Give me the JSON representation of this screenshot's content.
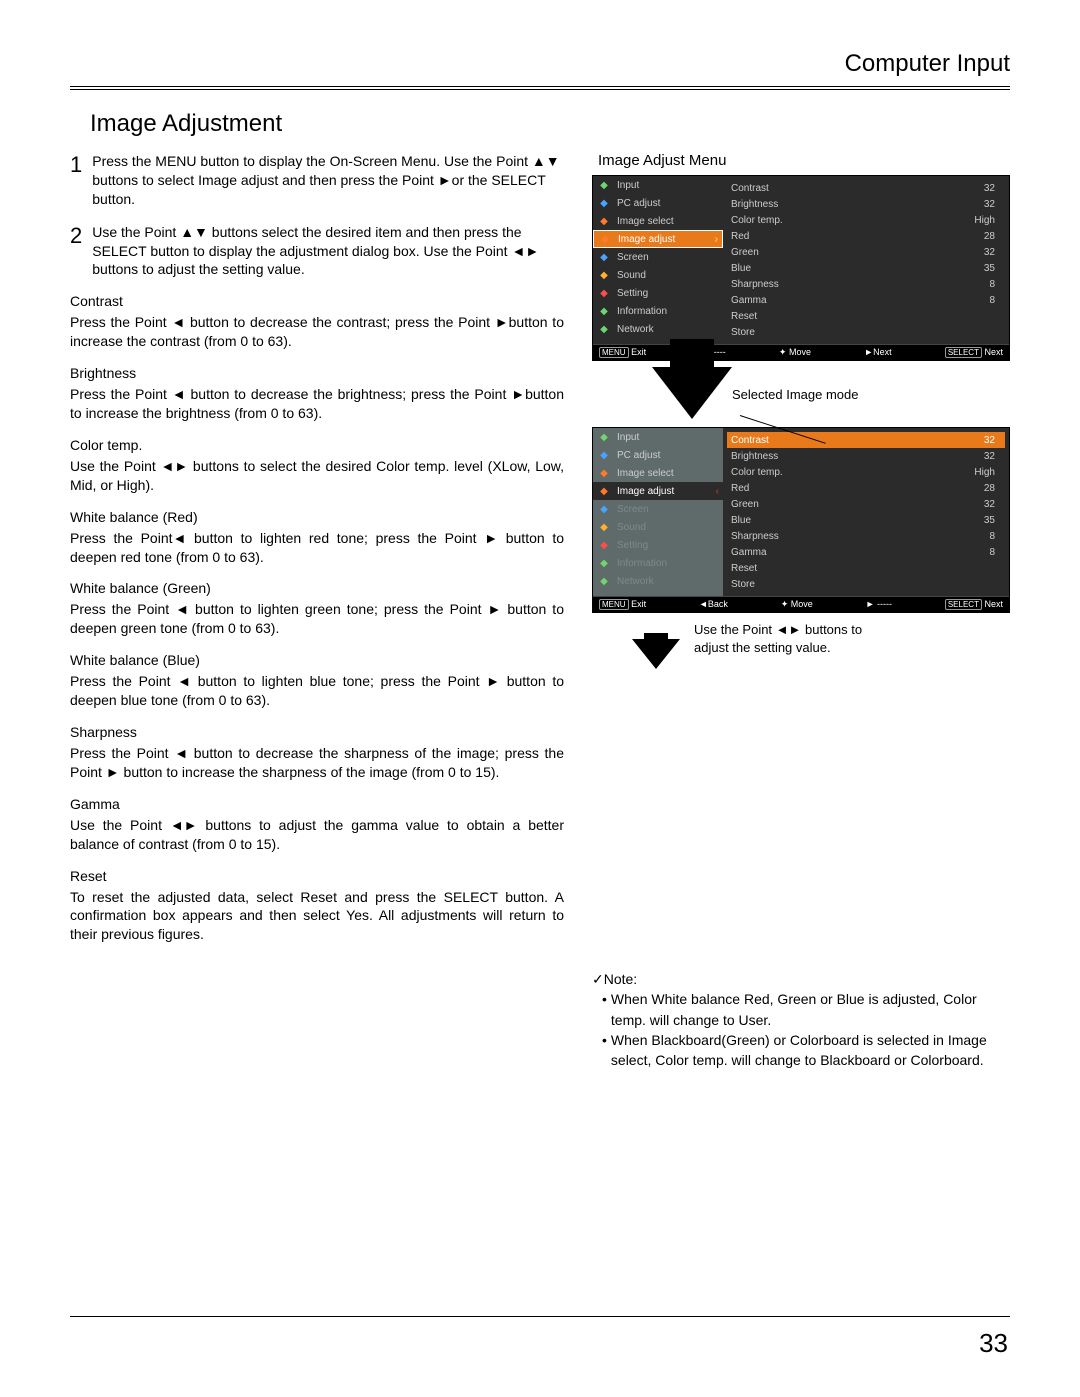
{
  "header": "Computer Input",
  "title": "Image Adjustment",
  "steps": [
    {
      "num": "1",
      "text": "Press the MENU button to display the On-Screen Menu. Use the Point ▲▼ buttons to select Image adjust  and then press the Point ►or the SELECT button."
    },
    {
      "num": "2",
      "text": "Use the Point ▲▼ buttons select the desired item and then press the SELECT button to display the adjustment dialog box. Use the Point ◄► buttons to adjust the setting value."
    }
  ],
  "params": [
    {
      "t": "Contrast",
      "b": "Press the Point ◄ button to decrease the contrast; press the Point ►button to increase the contrast (from 0 to 63)."
    },
    {
      "t": "Brightness",
      "b": "Press the Point ◄ button to decrease the brightness; press the Point ►button to increase the brightness (from 0 to 63)."
    },
    {
      "t": "Color temp.",
      "b": "Use the Point ◄► buttons to select the desired Color temp. level (XLow, Low, Mid, or High)."
    },
    {
      "t": "White balance (Red)",
      "b": "Press the Point◄ button to lighten red tone; press the Point ► button to deepen red tone (from 0 to 63)."
    },
    {
      "t": "White balance (Green)",
      "b": "Press the Point ◄ button to lighten green tone; press the Point ► button to deepen green tone (from 0 to 63)."
    },
    {
      "t": "White balance (Blue)",
      "b": "Press the Point ◄ button to lighten blue tone; press the Point ► button to deepen blue tone (from 0 to 63)."
    },
    {
      "t": "Sharpness",
      "b": "Press the Point ◄ button to decrease the sharpness of the image; press the Point ► button to increase the sharpness of the image (from 0 to 15)."
    },
    {
      "t": "Gamma",
      "b": "Use the Point ◄► buttons to adjust the gamma value to obtain a better balance of contrast (from 0 to 15)."
    },
    {
      "t": "Reset",
      "b": "To reset the adjusted data, select Reset and press the SELECT button. A confirmation box appears and then select Yes. All adjustments will return to their previous figures."
    }
  ],
  "right_title": "Image Adjust Menu",
  "osd_menu_items": [
    "Input",
    "PC adjust",
    "Image select",
    "Image adjust",
    "Screen",
    "Sound",
    "Setting",
    "Information",
    "Network"
  ],
  "osd1_rows": [
    {
      "l": "Contrast",
      "v": "32"
    },
    {
      "l": "Brightness",
      "v": "32"
    },
    {
      "l": "Color temp.",
      "v": "High"
    },
    {
      "l": "Red",
      "v": "28"
    },
    {
      "l": "Green",
      "v": "32"
    },
    {
      "l": "Blue",
      "v": "35"
    },
    {
      "l": "Sharpness",
      "v": "8"
    },
    {
      "l": "Gamma",
      "v": "8"
    },
    {
      "l": "Reset",
      "v": ""
    },
    {
      "l": "Store",
      "v": ""
    }
  ],
  "osd1_bar": [
    "MENU Exit",
    "◄ -----",
    "✦ Move",
    "►Next",
    "SELECT Next"
  ],
  "osd2_rows": [
    {
      "l": "Contrast",
      "v": "32",
      "sel": true
    },
    {
      "l": "Brightness",
      "v": "32"
    },
    {
      "l": "Color temp.",
      "v": "High"
    },
    {
      "l": "Red",
      "v": "28"
    },
    {
      "l": "Green",
      "v": "32"
    },
    {
      "l": "Blue",
      "v": "35"
    },
    {
      "l": "Sharpness",
      "v": "8"
    },
    {
      "l": "Gamma",
      "v": "8"
    },
    {
      "l": "Reset",
      "v": ""
    },
    {
      "l": "Store",
      "v": ""
    }
  ],
  "osd2_bar": [
    "MENU Exit",
    "◄Back",
    "✦ Move",
    "► -----",
    "SELECT Next"
  ],
  "selected_caption": "Selected Image mode",
  "point_caption": "Use the Point ◄► buttons to adjust the setting value.",
  "note_head": "✓Note:",
  "note_items": [
    "When White balance Red, Green or Blue is adjusted, Color temp.  will change to User.",
    "When Blackboard(Green)  or Colorboard is selected in Image select, Color temp.  will change to Blackboard  or Colorboard."
  ],
  "page_num": "33",
  "icon_colors": [
    "#6fd66f",
    "#4aa3ff",
    "#ff7a2a",
    "#ff7a2a",
    "#4aa3ff",
    "#ffb030",
    "#ff4d4d",
    "#6fd66f",
    "#6fd66f"
  ]
}
